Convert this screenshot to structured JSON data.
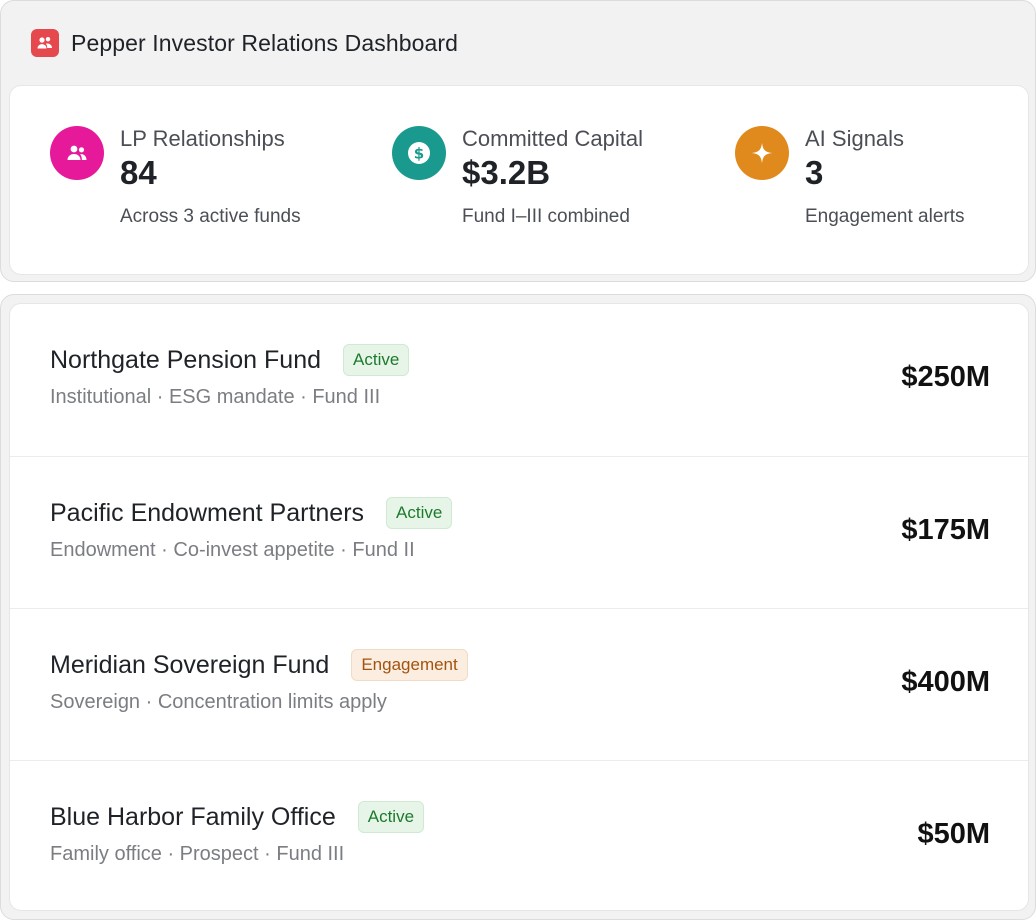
{
  "app": {
    "title": "Pepper Investor Relations Dashboard",
    "logo_icon": "people-icon",
    "logo_color": "#e5484d"
  },
  "stats": [
    {
      "label": "LP Relationships",
      "value": "84",
      "sub": "Across 3 active funds",
      "icon": "users-icon",
      "color": "#e5199a"
    },
    {
      "label": "Committed Capital",
      "value": "$3.2B",
      "sub": "Fund I–III combined",
      "icon": "dollar-icon",
      "color": "#1a9a8e"
    },
    {
      "label": "AI Signals",
      "value": "3",
      "sub": "Engagement alerts",
      "icon": "sparkle-icon",
      "color": "#e08a1e"
    }
  ],
  "lps": [
    {
      "name": "Northgate Pension Fund",
      "status": "Active",
      "meta": "Institutional · ESG mandate · Fund III",
      "amount": "$250M"
    },
    {
      "name": "Pacific Endowment Partners",
      "status": "Active",
      "meta": "Endowment · Co-invest appetite · Fund II",
      "amount": "$175M"
    },
    {
      "name": "Meridian Sovereign Fund",
      "status": "Engagement",
      "meta": "Sovereign · Concentration limits apply",
      "amount": "$400M"
    },
    {
      "name": "Blue Harbor Family Office",
      "status": "Active",
      "meta": "Family office · Prospect · Fund III",
      "amount": "$50M"
    }
  ]
}
